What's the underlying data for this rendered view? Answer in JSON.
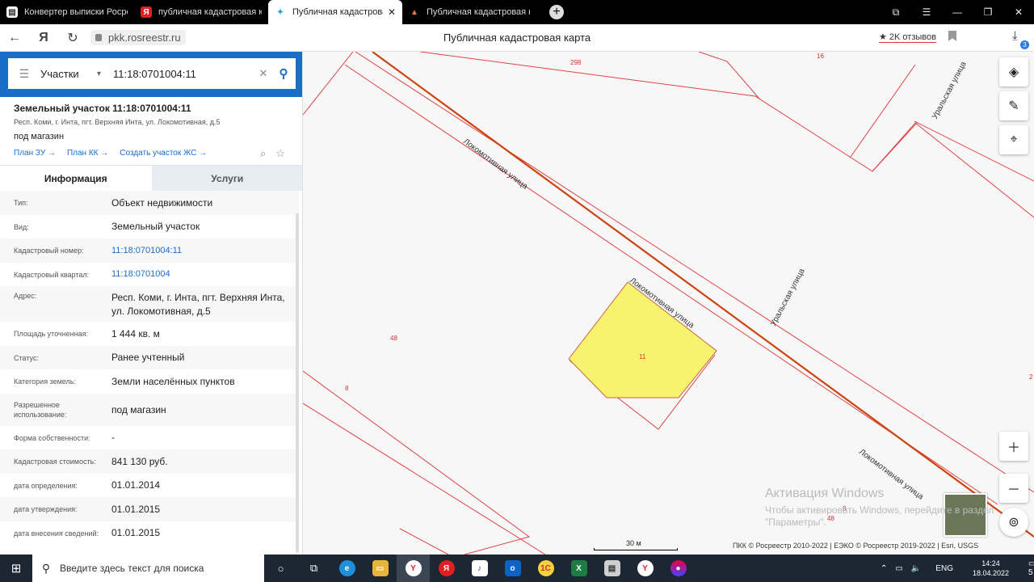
{
  "browser": {
    "tabs": [
      {
        "label": "Конвертер выписки Росреестр",
        "icon": "document-icon",
        "active": false
      },
      {
        "label": "публичная кадастровая к",
        "icon": "yandex-icon",
        "active": false
      },
      {
        "label": "Публичная кадастровая",
        "icon": "rosreestr-icon",
        "active": true
      },
      {
        "label": "Публичная кадастровая к",
        "icon": "map-icon",
        "active": false
      }
    ],
    "new_tab": "+",
    "url": "pkk.rosreestr.ru",
    "page_title": "Публичная кадастровая карта",
    "reviews": "★ 2K отзывов",
    "downloads_badge": "3"
  },
  "search": {
    "type": "Участки",
    "query": "11:18:0701004:11"
  },
  "object": {
    "title": "Земельный участок 11:18:0701004:11",
    "address": "Респ. Коми, г. Инта, пгт. Верхняя Инта, ул. Локомотивная, д.5",
    "use": "под магазин",
    "links": [
      "План ЗУ",
      "План КК",
      "Создать участок ЖС"
    ]
  },
  "info_tabs": {
    "info": "Информация",
    "services": "Услуги"
  },
  "rows": [
    {
      "k": "Тип:",
      "v": "Объект недвижимости"
    },
    {
      "k": "Вид:",
      "v": "Земельный участок"
    },
    {
      "k": "Кадастровый номер:",
      "v": "11:18:0701004:11"
    },
    {
      "k": "Кадастровый квартал:",
      "v": "11:18:0701004"
    },
    {
      "k": "Адрес:",
      "v": "Респ. Коми, г. Инта, пгт. Верхняя Инта, ул. Локомотивная, д.5"
    },
    {
      "k": "Площадь уточненная:",
      "v": "1 444 кв. м"
    },
    {
      "k": "Статус:",
      "v": "Ранее учтенный"
    },
    {
      "k": "Категория земель:",
      "v": "Земли населённых пунктов"
    },
    {
      "k": "Разрешенное использование:",
      "v": "под магазин"
    },
    {
      "k": "Форма собственности:",
      "v": "-"
    },
    {
      "k": "Кадастровая стоимость:",
      "v": "841 130 руб."
    },
    {
      "k": "дата определения:",
      "v": "01.01.2014"
    },
    {
      "k": "дата утверждения:",
      "v": "01.01.2015"
    },
    {
      "k": "дата внесения сведений:",
      "v": "01.01.2015"
    }
  ],
  "map": {
    "parcel_label": "11",
    "street_labels": [
      "Локомотивная улица",
      "Локомотивная улица",
      "Локомотивная улица",
      "Уральская улица",
      "Уральская улица"
    ],
    "number_labels": [
      "298",
      "16",
      "48",
      "8",
      "48",
      "8",
      "2"
    ],
    "scale": "30 м",
    "attribution": "ПКК © Росреестр 2010-2022 | ЕЭКО © Росреестр 2019-2022 | Esri, USGS",
    "watermark_title": "Активация Windows",
    "watermark_text": "Чтобы активировать Windows, перейдите в раздел \"Параметры\"."
  },
  "taskbar": {
    "search_placeholder": "Введите здесь текст для поиска",
    "lang": "ENG",
    "time": "14:24",
    "date": "18.04.2022",
    "notif": "5"
  }
}
